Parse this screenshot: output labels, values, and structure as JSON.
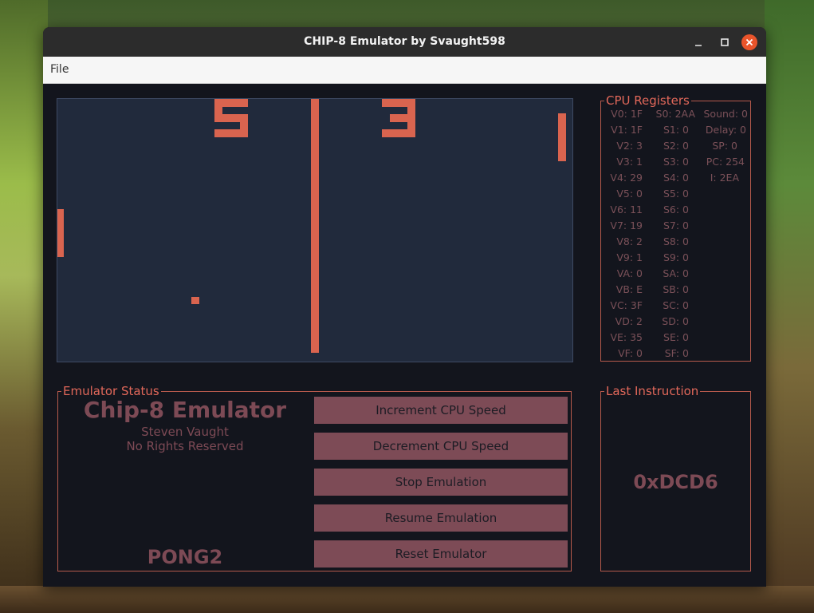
{
  "window": {
    "title": "CHIP-8 Emulator by Svaught598"
  },
  "menu": {
    "file_label": "File"
  },
  "game_screen": {
    "score_left": "5",
    "score_right": "3",
    "pixel_color": "#d9644f",
    "background_color": "#212a3c"
  },
  "registers": {
    "legend": "CPU Registers",
    "v": [
      "V0: 1F",
      "V1: 1F",
      "V2: 3",
      "V3: 1",
      "V4: 29",
      "V5: 0",
      "V6: 11",
      "V7: 19",
      "V8: 2",
      "V9: 1",
      "VA: 0",
      "VB: E",
      "VC: 3F",
      "VD: 2",
      "VE: 35",
      "VF: 0"
    ],
    "s": [
      "S0: 2AA",
      "S1: 0",
      "S2: 0",
      "S3: 0",
      "S4: 0",
      "S5: 0",
      "S6: 0",
      "S7: 0",
      "S8: 0",
      "S9: 0",
      "SA: 0",
      "SB: 0",
      "SC: 0",
      "SD: 0",
      "SE: 0",
      "SF: 0"
    ],
    "misc": [
      "Sound: 0",
      "Delay: 0",
      "SP: 0",
      "PC: 254",
      "I: 2EA"
    ]
  },
  "status": {
    "legend": "Emulator Status",
    "title": "Chip-8 Emulator",
    "author": "Steven Vaught",
    "rights": "No Rights Reserved",
    "rom": "PONG2",
    "buttons": {
      "increment": "Increment CPU Speed",
      "decrement": "Decrement CPU Speed",
      "stop": "Stop Emulation",
      "resume": "Resume Emulation",
      "reset": "Reset Emulator"
    }
  },
  "last_instruction": {
    "legend": "Last Instruction",
    "value": "0xDCD6"
  },
  "colors": {
    "accent": "#e2685a",
    "muted_text": "#7d4a55",
    "window_bg": "#13151d",
    "titlebar_bg": "#2c2c2c",
    "close_button": "#e9542b"
  }
}
